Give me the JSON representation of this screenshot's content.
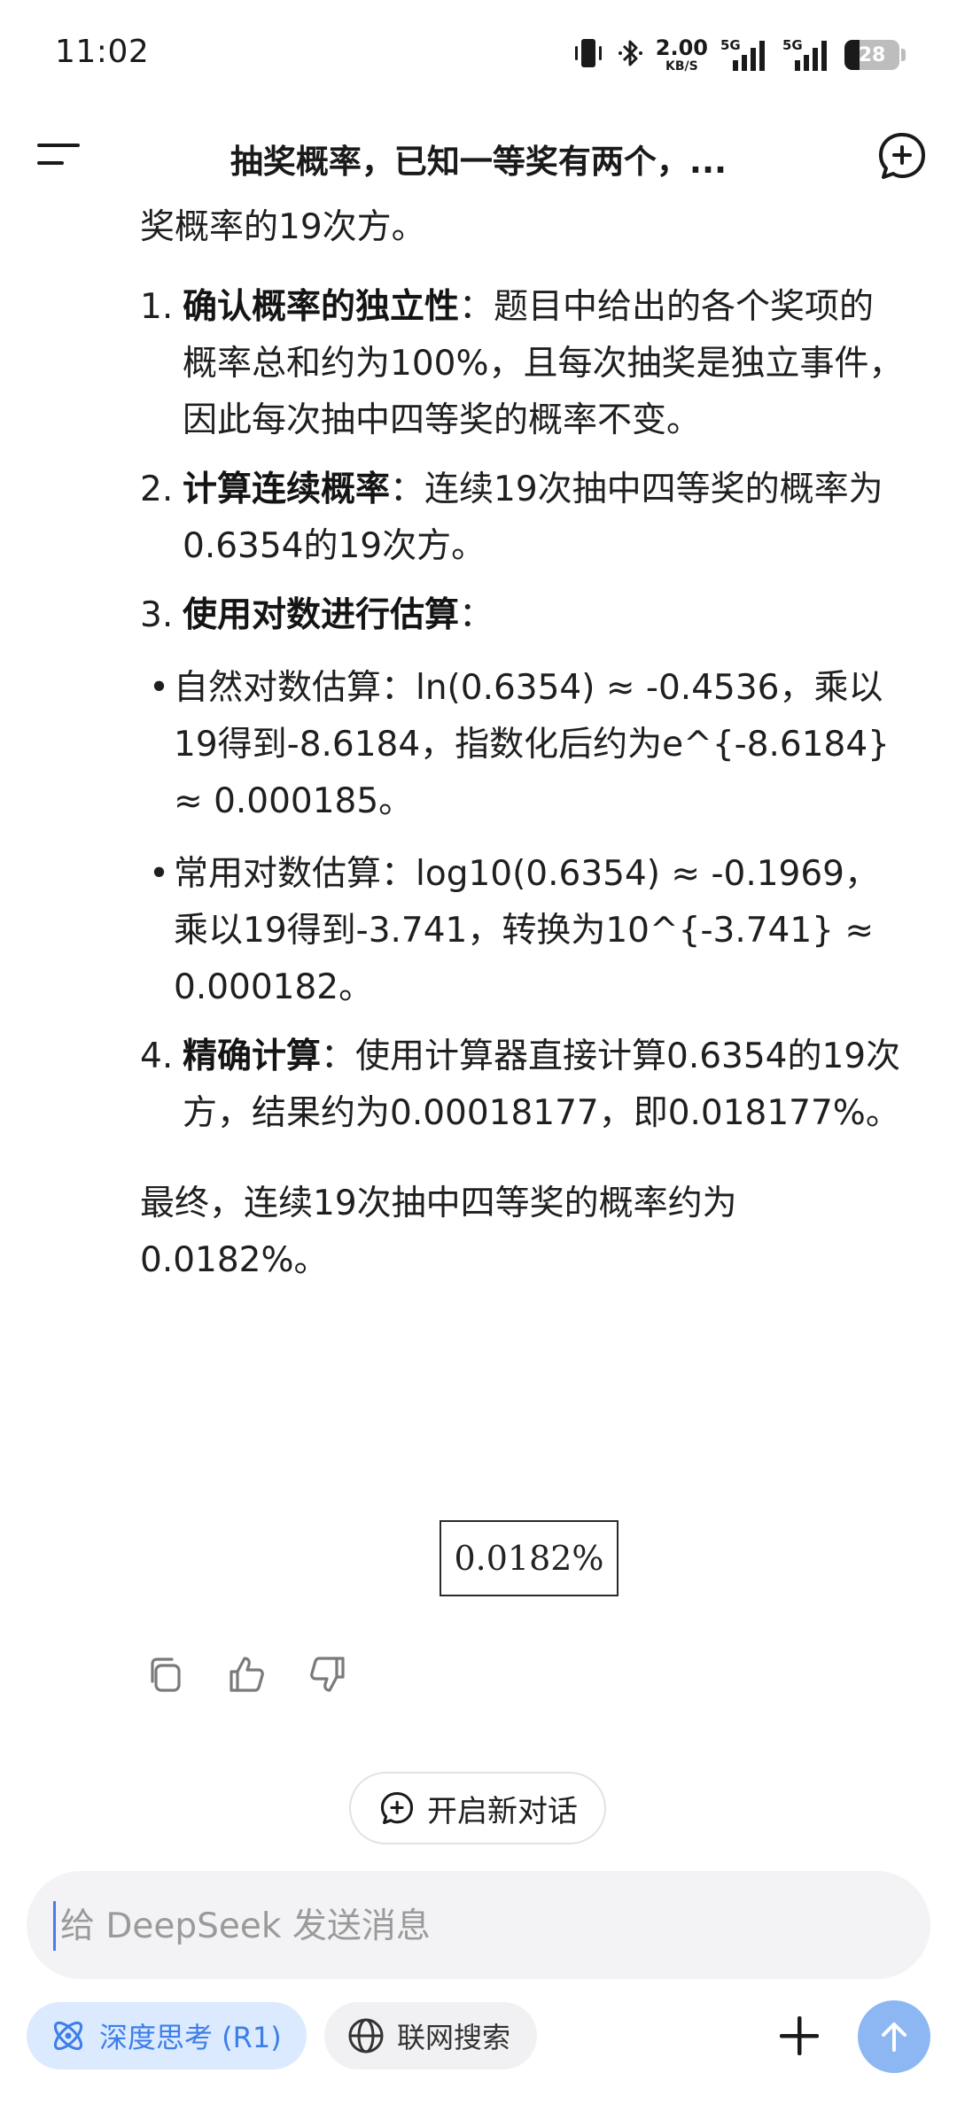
{
  "status_bar": {
    "time": "11:02",
    "net_speed_value": "2.00",
    "net_speed_unit": "KB/S",
    "signal_1_label": "5G",
    "signal_2_label": "5G",
    "battery_level": "28",
    "icons": [
      "vibrate-icon",
      "bluetooth-icon",
      "signal-icon",
      "battery-icon"
    ]
  },
  "header": {
    "title": "抽奖概率，已知一等奖有两个，...",
    "icons": [
      "menu-icon",
      "new-chat-icon"
    ]
  },
  "message": {
    "intro": "奖概率的19次方。",
    "steps": [
      {
        "num": "1.",
        "bold": "确认概率的独立性",
        "text": "：题目中给出的各个奖项的概率总和约为100%，且每次抽奖是独立事件，因此每次抽中四等奖的概率不变。"
      },
      {
        "num": "2.",
        "bold": "计算连续概率",
        "text": "：连续19次抽中四等奖的概率为0.6354的19次方。"
      },
      {
        "num": "3.",
        "bold": "使用对数进行估算",
        "text": "：",
        "bullets": [
          "自然对数估算：ln(0.6354) ≈ -0.4536，乘以19得到-8.6184，指数化后约为e^{-8.6184} ≈ 0.000185。",
          "常用对数估算：log10(0.6354) ≈ -0.1969，乘以19得到-3.741，转换为10^{-3.741} ≈ 0.000182。"
        ]
      },
      {
        "num": "4.",
        "bold": "精确计算",
        "text": "：使用计算器直接计算0.6354的19次方，结果约为0.00018177，即0.018177%。"
      }
    ],
    "conclusion": "最终，连续19次抽中四等奖的概率约为0.0182%。",
    "boxed_result": "0.0182%",
    "bullet_char": "•"
  },
  "actions": {
    "icons": [
      "copy-icon",
      "thumbs-up-icon",
      "thumbs-down-icon"
    ]
  },
  "new_dialog": {
    "label": "开启新对话",
    "icon": "new-chat-icon"
  },
  "composer": {
    "placeholder": "给 DeepSeek 发送消息",
    "value": ""
  },
  "toolbar": {
    "deep_think_label": "深度思考 (R1)",
    "web_search_label": "联网搜索",
    "accent": "#3d7ee8",
    "send_bg": "#8db7f3",
    "icons": [
      "atom-icon",
      "globe-icon",
      "plus-icon",
      "arrow-up-icon"
    ]
  }
}
